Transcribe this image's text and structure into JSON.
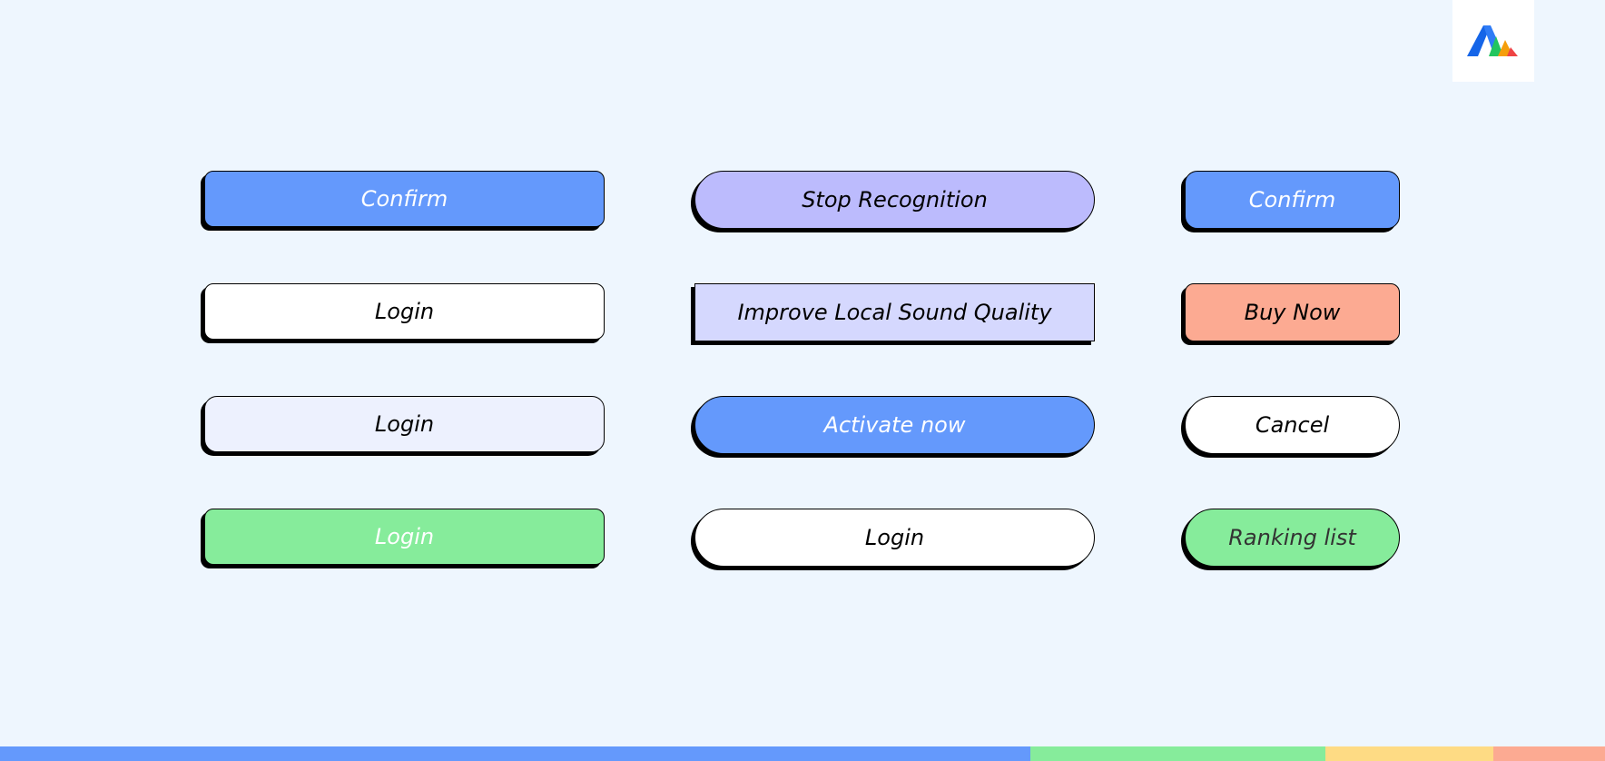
{
  "logo": {
    "colors": [
      "#1565e8",
      "#22c55e",
      "#f59e0b",
      "#ef4444"
    ]
  },
  "buttons": {
    "c1r1": {
      "label": "Confirm",
      "bg": "#6499fc",
      "color": "#ffffff"
    },
    "c1r2": {
      "label": "Login",
      "bg": "#ffffff",
      "color": "#000000"
    },
    "c1r3": {
      "label": "Login",
      "bg": "#edf1fe",
      "color": "#000000"
    },
    "c1r4": {
      "label": "Login",
      "bg": "#86ec9b",
      "color": "#ffffff"
    },
    "c2r1": {
      "label": "Stop Recognition",
      "bg": "#bcbbfd",
      "color": "#000000"
    },
    "c2r2": {
      "label": "Improve Local Sound Quality",
      "bg": "#d5d8fe",
      "color": "#000000"
    },
    "c2r3": {
      "label": "Activate now",
      "bg": "#6499fc",
      "color": "#ffffff"
    },
    "c2r4": {
      "label": "Login",
      "bg": "#ffffff",
      "color": "#000000"
    },
    "c3r1": {
      "label": "Confirm",
      "bg": "#6499fc",
      "color": "#ffffff"
    },
    "c3r2": {
      "label": "Buy Now",
      "bg": "#fcaa92",
      "color": "#000000"
    },
    "c3r3": {
      "label": "Cancel",
      "bg": "#ffffff",
      "color": "#000000"
    },
    "c3r4": {
      "label": "Ranking list",
      "bg": "#86ec9b",
      "color": "#333333"
    }
  },
  "bottom_bar": {
    "colors": [
      "#6499fc",
      "#86ec9b",
      "#fedb84",
      "#fcaa92"
    ]
  }
}
